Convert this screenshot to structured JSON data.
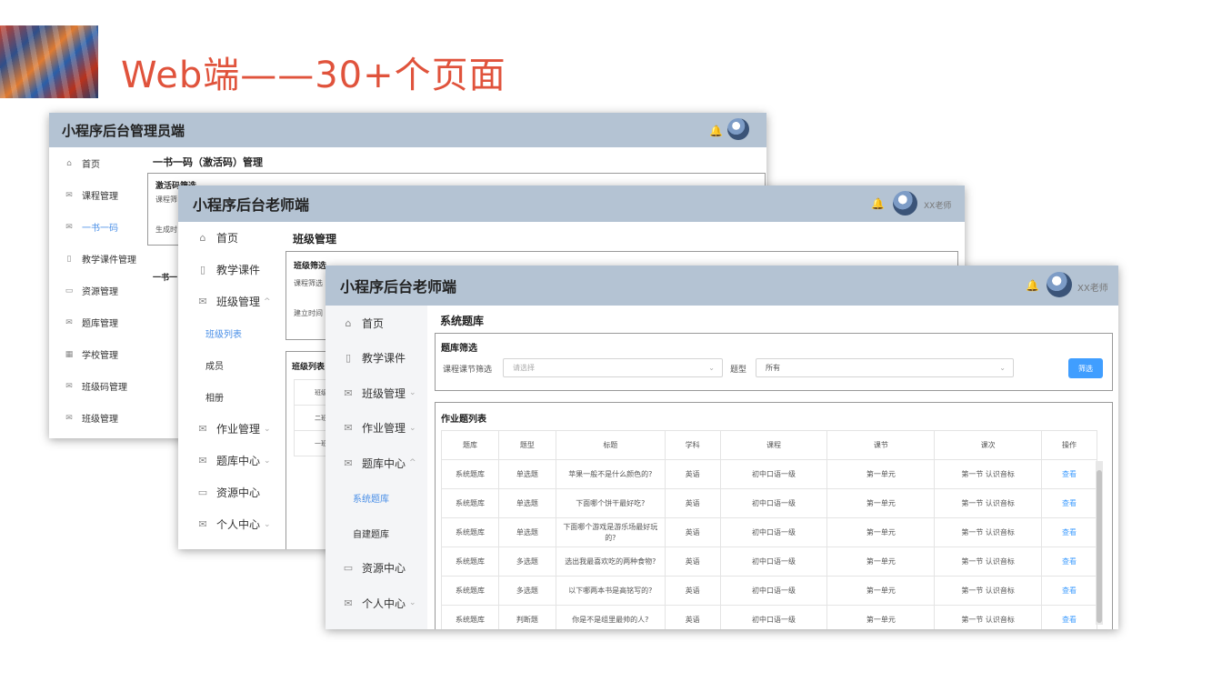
{
  "headline": "Web端——30+个页面",
  "admin": {
    "title": "小程序后台管理员端",
    "nav": [
      {
        "label": "首页",
        "icon": "home-icon"
      },
      {
        "label": "课程管理",
        "icon": "mail-icon"
      },
      {
        "label": "一书一码",
        "icon": "mail-icon"
      },
      {
        "label": "教学课件管理",
        "icon": "book-icon"
      },
      {
        "label": "资源管理",
        "icon": "box-icon"
      },
      {
        "label": "题库管理",
        "icon": "mail-icon"
      },
      {
        "label": "学校管理",
        "icon": "building-icon"
      },
      {
        "label": "班级码管理",
        "icon": "mail-icon"
      },
      {
        "label": "班级管理",
        "icon": "mail-icon"
      }
    ],
    "page_title": "一书一码（激活码）管理",
    "filter_title": "激活码筛选",
    "filter_course": "课程筛",
    "filter_gen": "生成时",
    "list_title": "一书一"
  },
  "teacher": {
    "title": "小程序后台老师端",
    "user": "XX老师",
    "nav": [
      {
        "label": "首页",
        "icon": "home-icon"
      },
      {
        "label": "教学课件",
        "icon": "book-icon"
      },
      {
        "label": "班级管理",
        "icon": "mail-icon",
        "chev": "^"
      },
      {
        "label": "班级列表",
        "sub": true
      },
      {
        "label": "成员",
        "sub": true
      },
      {
        "label": "相册",
        "sub": true
      },
      {
        "label": "作业管理",
        "icon": "mail-icon",
        "chev": "⌄"
      },
      {
        "label": "题库中心",
        "icon": "mail-icon",
        "chev": "⌄"
      },
      {
        "label": "资源中心",
        "icon": "box-icon"
      },
      {
        "label": "个人中心",
        "icon": "mail-icon",
        "chev": "⌄"
      }
    ],
    "page_title": "班级管理",
    "filter_title": "班级筛选",
    "filter_course": "课程筛选",
    "filter_time": "建立时间",
    "list_title": "班级列表",
    "list_header": "班级",
    "rows": [
      "二班",
      "一班"
    ]
  },
  "bank": {
    "title": "小程序后台老师端",
    "user": "XX老师",
    "nav": [
      {
        "label": "首页",
        "icon": "home-icon"
      },
      {
        "label": "教学课件",
        "icon": "book-icon"
      },
      {
        "label": "班级管理",
        "icon": "mail-icon",
        "chev": "⌄"
      },
      {
        "label": "作业管理",
        "icon": "mail-icon",
        "chev": "⌄"
      },
      {
        "label": "题库中心",
        "icon": "mail-icon",
        "chev": "^"
      },
      {
        "label": "系统题库",
        "sub": true
      },
      {
        "label": "自建题库",
        "sub": true
      },
      {
        "label": "资源中心",
        "icon": "box-icon"
      },
      {
        "label": "个人中心",
        "icon": "mail-icon",
        "chev": "⌄"
      }
    ],
    "page_title": "系统题库",
    "filter_title": "题库筛选",
    "course_label": "课程课节筛选",
    "course_placeholder": "请选择",
    "type_label": "题型",
    "type_value": "所有",
    "filter_button": "筛选",
    "list_title": "作业题列表",
    "columns": [
      "题库",
      "题型",
      "标题",
      "学科",
      "课程",
      "课节",
      "课次",
      "操作"
    ],
    "rows": [
      [
        "系统题库",
        "单选题",
        "苹果一般不是什么颜色的?",
        "英语",
        "初中口语一级",
        "第一单元",
        "第一节 认识音标",
        "查看"
      ],
      [
        "系统题库",
        "单选题",
        "下面哪个饼干最好吃?",
        "英语",
        "初中口语一级",
        "第一单元",
        "第一节 认识音标",
        "查看"
      ],
      [
        "系统题库",
        "单选题",
        "下面哪个游戏是游乐场最好玩的?",
        "英语",
        "初中口语一级",
        "第一单元",
        "第一节 认识音标",
        "查看"
      ],
      [
        "系统题库",
        "多选题",
        "选出我最喜欢吃的两种食物?",
        "英语",
        "初中口语一级",
        "第一单元",
        "第一节 认识音标",
        "查看"
      ],
      [
        "系统题库",
        "多选题",
        "以下哪两本书是高铭写的?",
        "英语",
        "初中口语一级",
        "第一单元",
        "第一节 认识音标",
        "查看"
      ],
      [
        "系统题库",
        "判断题",
        "你是不是组里最帅的人?",
        "英语",
        "初中口语一级",
        "第一单元",
        "第一节 认识音标",
        "查看"
      ]
    ]
  },
  "colors": {
    "accent": "#409eff",
    "titlebar": "#b4c3d3",
    "headline": "#e0533c"
  }
}
